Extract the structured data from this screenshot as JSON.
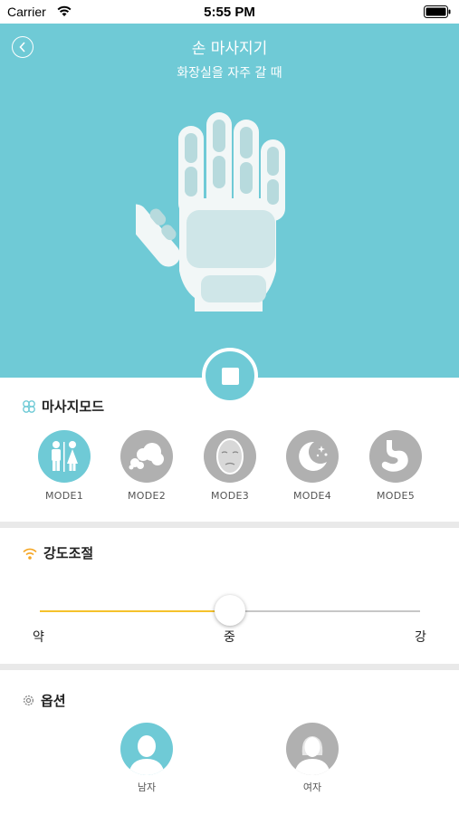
{
  "status_bar": {
    "carrier": "Carrier",
    "time": "5:55 PM"
  },
  "header": {
    "title": "손 마사지기",
    "subtitle": "화장실을 자주 갈 때"
  },
  "modes_section": {
    "title": "마사지모드",
    "items": [
      {
        "label": "MODE1",
        "icon": "restroom-icon",
        "active": true
      },
      {
        "label": "MODE2",
        "icon": "cloud-puff-icon",
        "active": false
      },
      {
        "label": "MODE3",
        "icon": "face-icon",
        "active": false
      },
      {
        "label": "MODE4",
        "icon": "moon-stars-icon",
        "active": false
      },
      {
        "label": "MODE5",
        "icon": "stomach-icon",
        "active": false
      }
    ]
  },
  "intensity_section": {
    "title": "강도조절",
    "min_label": "약",
    "mid_label": "중",
    "max_label": "강",
    "value_fraction": 0.5
  },
  "options_section": {
    "title": "옵션",
    "male_label": "남자",
    "female_label": "여자",
    "selected": "male"
  },
  "colors": {
    "accent": "#6fcad6",
    "slider_fill": "#f5c22b",
    "inactive": "#b0b0b0",
    "divider": "#e9e9e9"
  }
}
